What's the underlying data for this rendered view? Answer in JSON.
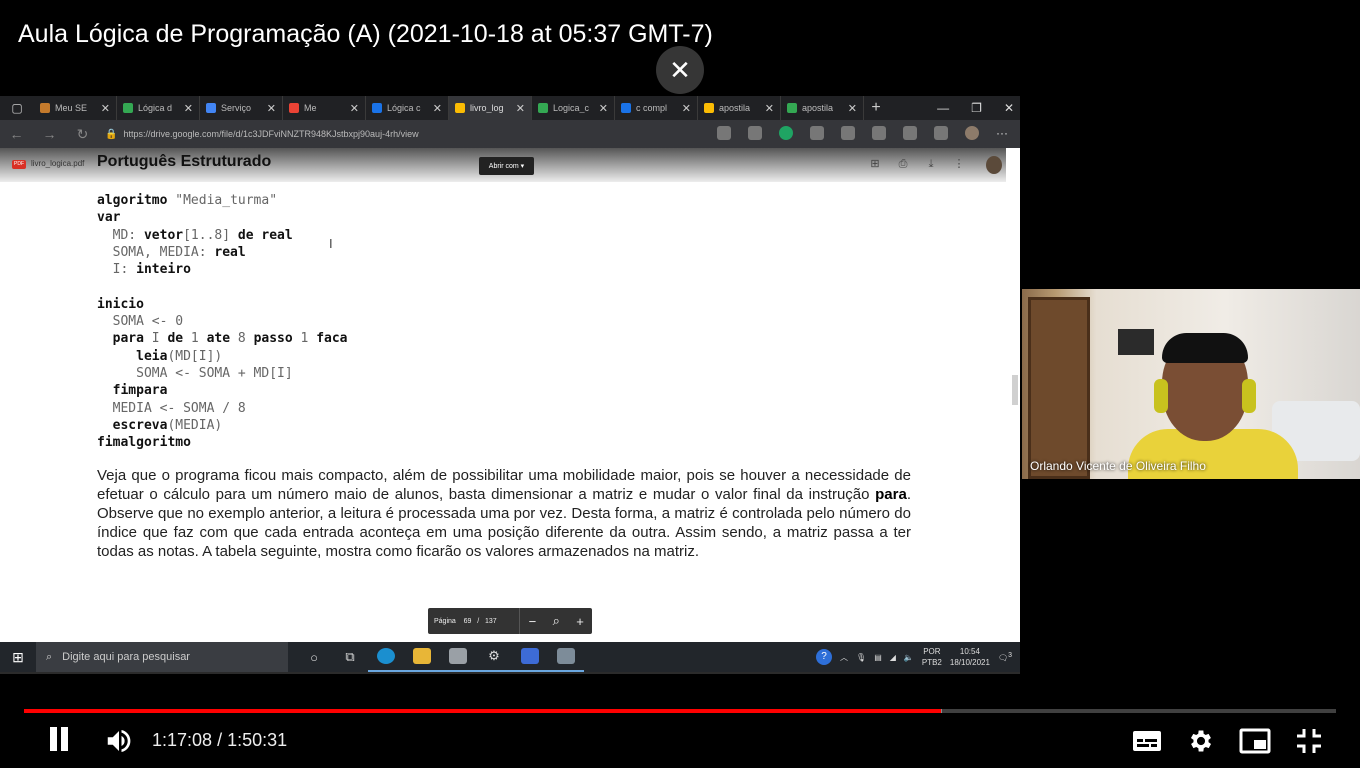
{
  "video": {
    "title": "Aula Lógica de Programação (A) (2021-10-18 at 05:37 GMT-7)",
    "current_time": "1:17:08",
    "duration": "1:50:31",
    "time_separator": "/",
    "progress_played_fraction": 0.699,
    "progress_buffered_fraction": 0.7
  },
  "browser": {
    "tabs": [
      {
        "label": "Meu SE",
        "color": "#c47a2c"
      },
      {
        "label": "Lógica d",
        "color": "#34a853"
      },
      {
        "label": "Serviço",
        "color": "#4285f4"
      },
      {
        "label": "Me",
        "color": "#ea4335"
      },
      {
        "label": "Lógica c",
        "color": "#1a73e8"
      },
      {
        "label": "livro_log",
        "color": "#fbbc04",
        "active": true
      },
      {
        "label": "Logica_c",
        "color": "#34a853"
      },
      {
        "label": "c compl",
        "color": "#1a73e8"
      },
      {
        "label": "apostila",
        "color": "#fbbc04"
      },
      {
        "label": "apostila",
        "color": "#34a853"
      }
    ],
    "url": "https://drive.google.com/file/d/1c3JDFviNNZTR948KJstbxpj90auj-4rh/view"
  },
  "viewer": {
    "pdf_badge": "PDF",
    "file_name": "livro_logica.pdf",
    "heading": "Português Estruturado",
    "open_with": "Abrir com ▾",
    "page_label": "Página",
    "page_current": "69",
    "page_sep": "/",
    "page_total": "137"
  },
  "code_lines": [
    {
      "kw": "algoritmo",
      "rest": " \"Media_turma\"",
      "indent": ""
    },
    {
      "kw": "var",
      "rest": "",
      "indent": ""
    },
    {
      "kw": "",
      "rest": "MD: ",
      "kw2": "vetor",
      "rest2": "[1..8] ",
      "kw3": "de real",
      "indent": "  "
    },
    {
      "kw": "",
      "rest": "SOMA, MEDIA: ",
      "kw2": "real",
      "indent": "  "
    },
    {
      "kw": "",
      "rest": "I: ",
      "kw2": "inteiro",
      "indent": "  "
    },
    {
      "kw": "",
      "rest": "",
      "indent": ""
    },
    {
      "kw": "inicio",
      "rest": "",
      "indent": ""
    },
    {
      "kw": "",
      "rest": "SOMA <- 0",
      "indent": "  "
    },
    {
      "kw": "para",
      "rest": " I ",
      "kw2": "de",
      "rest2": " 1 ",
      "kw3": "ate",
      "rest3": " 8 ",
      "kw4": "passo",
      "rest4": " 1 ",
      "kw5": "faca",
      "indent": "  "
    },
    {
      "kw": "leia",
      "rest": "(MD[I])",
      "indent": "     "
    },
    {
      "kw": "",
      "rest": "SOMA <- SOMA + MD[I]",
      "indent": "     "
    },
    {
      "kw": "fimpara",
      "rest": "",
      "indent": "  "
    },
    {
      "kw": "",
      "rest": "MEDIA <- SOMA / 8",
      "indent": "  "
    },
    {
      "kw": "escreva",
      "rest": "(MEDIA)",
      "indent": "  "
    },
    {
      "kw": "fimalgoritmo",
      "rest": "",
      "indent": ""
    }
  ],
  "paragraph": {
    "before": "Veja que o programa ficou mais compacto, além de possibilitar uma mobilidade maior, pois se houver a necessidade de efetuar o cálculo para um número maio de alunos, basta dimensionar a matriz e mudar o valor final da instrução ",
    "bold": "para",
    "after": ". Observe que no exemplo anterior, a leitura é processada uma por vez. Desta forma, a matriz é controlada pelo número do índice que faz com que cada entrada aconteça em uma posição diferente da outra. Assim sendo, a matriz passa a ter todas as notas. A tabela seguinte, mostra como ficarão os valores armazenados na matriz."
  },
  "taskbar": {
    "search_placeholder": "Digite aqui para pesquisar",
    "lang_line1": "POR",
    "lang_line2": "PTB2",
    "time": "10:54",
    "date": "18/10/2021",
    "notif_count": "3"
  },
  "webcam": {
    "participant_name": "Orlando Vicente de Oliveira Filho"
  },
  "icons": {
    "close": "close-icon",
    "pause": "pause-icon",
    "volume": "volume-icon",
    "subtitles": "subtitles-icon",
    "settings": "gear-icon",
    "miniplayer": "miniplayer-icon",
    "exit_fullscreen": "exit-fullscreen-icon"
  }
}
